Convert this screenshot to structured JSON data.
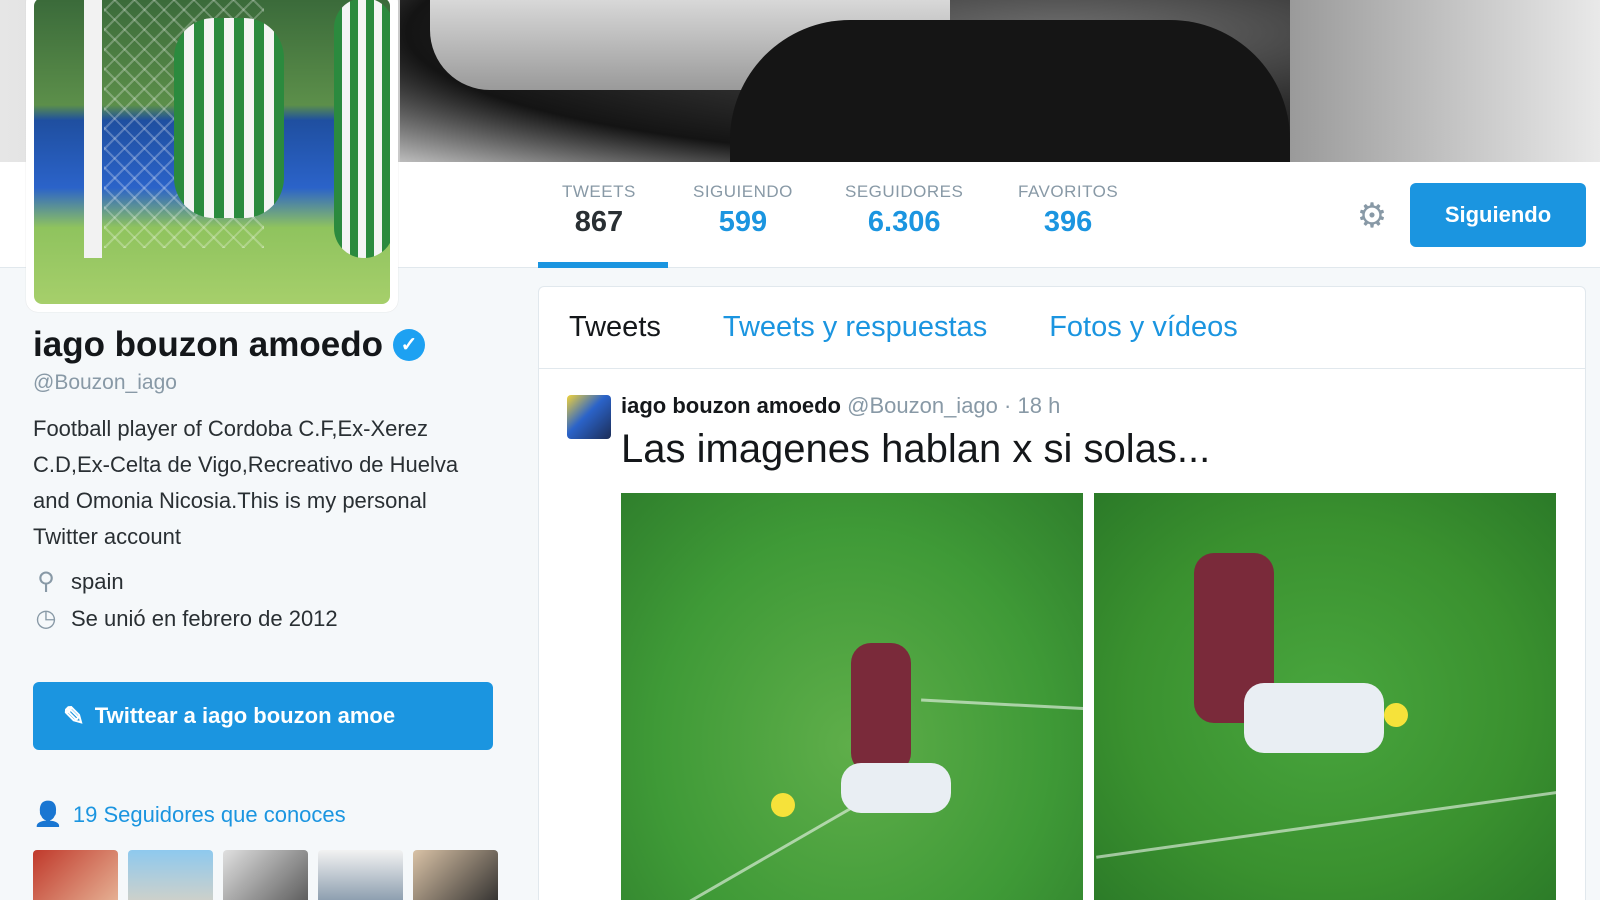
{
  "colors": {
    "accent": "#1b95e0",
    "text": "#292f33",
    "muted": "#8899a6",
    "page_bg": "#f5f8fa"
  },
  "profile": {
    "name": "iago bouzon amoedo",
    "handle": "@Bouzon_iago",
    "bio": "Football player of Cordoba C.F,Ex-Xerez C.D,Ex-Celta de Vigo,Recreativo de Huelva and Omonia Nicosia.This is my personal Twitter account",
    "location": "spain",
    "joined": "Se unió en febrero de 2012",
    "tweet_to_label": "Twittear a iago bouzon amoe",
    "followers_you_know": "19 Seguidores que conoces",
    "icons": {
      "verified": "verified-badge-icon",
      "location": "location-pin-icon",
      "joined": "clock-icon",
      "tweet_to": "compose-icon",
      "followers": "person-icon"
    }
  },
  "stats": [
    {
      "label": "TWEETS",
      "value": "867",
      "active": true
    },
    {
      "label": "SIGUIENDO",
      "value": "599"
    },
    {
      "label": "SEGUIDORES",
      "value": "6.306"
    },
    {
      "label": "FAVORITOS",
      "value": "396"
    }
  ],
  "actions": {
    "follow_label": "Siguiendo",
    "settings_icon": "gear-icon"
  },
  "timeline": {
    "tabs": [
      "Tweets",
      "Tweets y respuestas",
      "Fotos y vídeos"
    ],
    "active_tab": "Tweets"
  },
  "tweet": {
    "name": "iago bouzon amoedo",
    "handle": "@Bouzon_iago",
    "time": "18 h",
    "text": "Las imagenes hablan x si solas..."
  }
}
